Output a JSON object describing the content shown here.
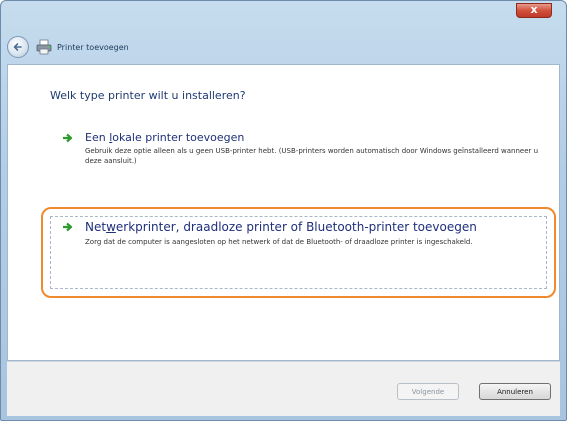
{
  "window": {
    "title": "Printer toevoegen",
    "close_label": "x"
  },
  "nav": {
    "icons": [
      "back-arrow-icon",
      "printer-icon"
    ]
  },
  "content": {
    "heading": "Welk type printer wilt u installeren?",
    "options": [
      {
        "title_parts": [
          "Een ",
          "l",
          "okale printer toevoegen"
        ],
        "description": "Gebruik deze optie alleen als u geen USB-printer hebt. (USB-printers worden automatisch door Windows geïnstalleerd wanneer u deze aansluit.)"
      },
      {
        "title_parts": [
          "Net",
          "w",
          "erkprinter, draadloze printer of Bluetooth-printer toevoegen"
        ],
        "description": "Zorg dat de computer is aangesloten op het netwerk of dat de Bluetooth- of draadloze printer is ingeschakeld.",
        "highlighted": true
      }
    ]
  },
  "footer": {
    "next_label": "Volgende",
    "cancel_label": "Annuleren"
  },
  "colors": {
    "highlight": "#f08a2e",
    "arrow": "#2e9b2e",
    "heading": "#1f3b71"
  }
}
